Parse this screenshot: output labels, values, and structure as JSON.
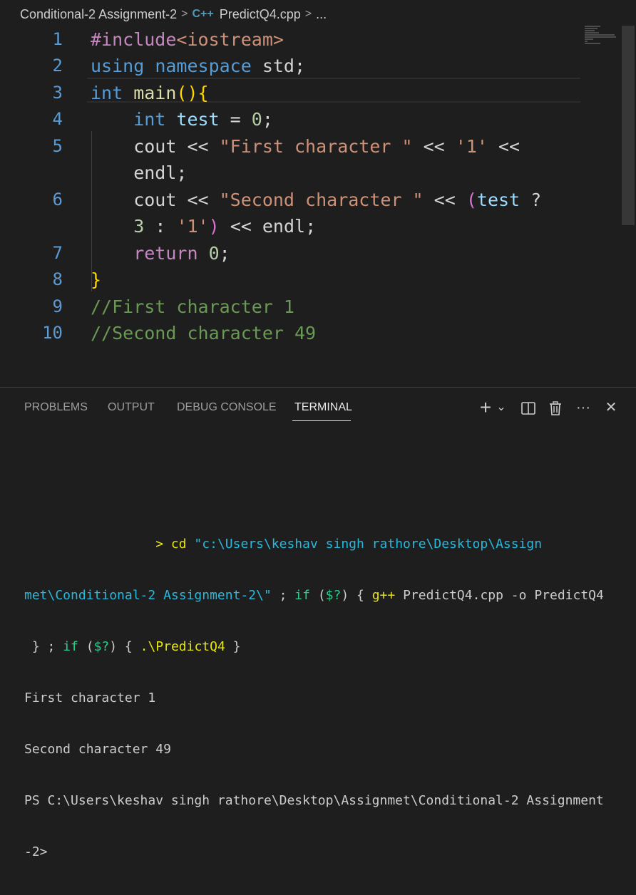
{
  "breadcrumb": {
    "folder": "Conditional-2 Assignment-2",
    "sep": ">",
    "file_icon": "C++",
    "file": "PredictQ4.cpp",
    "ellipsis": "..."
  },
  "editor": {
    "lines": [
      {
        "no": "1"
      },
      {
        "no": "2"
      },
      {
        "no": "3"
      },
      {
        "no": "4"
      },
      {
        "no": "5"
      },
      {
        "no": ""
      },
      {
        "no": "6"
      },
      {
        "no": ""
      },
      {
        "no": "7"
      },
      {
        "no": "8"
      },
      {
        "no": "9"
      },
      {
        "no": "10"
      }
    ],
    "tokens": {
      "l1_a": "#include",
      "l1_b": "<iostream>",
      "l2_a": "using",
      "l2_b": " namespace",
      "l2_c": " std;",
      "l3_a": "int",
      "l3_b": " main",
      "l3_c": "(){",
      "l4_a": "    int",
      "l4_b": " test",
      "l4_c": " = ",
      "l4_d": "0",
      "l4_e": ";",
      "l5_a": "    cout << ",
      "l5_b": "\"First character \"",
      "l5_c": " << ",
      "l5_d": "'1'",
      "l5_e": " <<",
      "l5w_a": "    endl;",
      "l6_a": "    cout << ",
      "l6_b": "\"Second character \"",
      "l6_c": " << ",
      "l6_d": "(",
      "l6_e": "test",
      "l6_f": " ?",
      "l6w_a": "    ",
      "l6w_b": "3",
      "l6w_c": " : ",
      "l6w_d": "'1'",
      "l6w_e": ")",
      "l6w_f": " << endl;",
      "l7_a": "    return",
      "l7_b": " ",
      "l7_c": "0",
      "l7_d": ";",
      "l8_a": "}",
      "l9_a": "//First character 1",
      "l10_a": "//Second character 49"
    }
  },
  "panel": {
    "tabs": [
      "PROBLEMS",
      "OUTPUT",
      "DEBUG CONSOLE",
      "TERMINAL"
    ],
    "active_tab": "TERMINAL",
    "tools": {
      "add": "+",
      "dropdown": "⌄",
      "split": "◫",
      "trash": "🗑",
      "more": "···",
      "close": "✕"
    }
  },
  "terminal": {
    "l1_prompt": "                 > ",
    "l1_cd": "cd",
    "l1_path": " \"c:\\Users\\keshav singh rathore\\Desktop\\Assign",
    "l2_path": "met\\Conditional-2 Assignment-2\\\"",
    "l2_rest1": " ; ",
    "l2_if": "if",
    "l2_rest2": " (",
    "l2_var": "$?",
    "l2_rest3": ") { ",
    "l2_gpp": "g++",
    "l2_rest4": " PredictQ4.cpp ",
    "l2_flag": "-o",
    "l2_rest5": " PredictQ4",
    "l3_rest1": " } ; ",
    "l3_if": "if",
    "l3_rest2": " (",
    "l3_var": "$?",
    "l3_rest3": ") { ",
    "l3_exe": ".\\PredictQ4",
    "l3_rest4": " }",
    "out1": "First character 1",
    "out2": "Second character 49",
    "ps1": "PS C:\\Users\\keshav singh rathore\\Desktop\\Assignmet\\Conditional-2 Assignment",
    "ps2": "-2>"
  }
}
